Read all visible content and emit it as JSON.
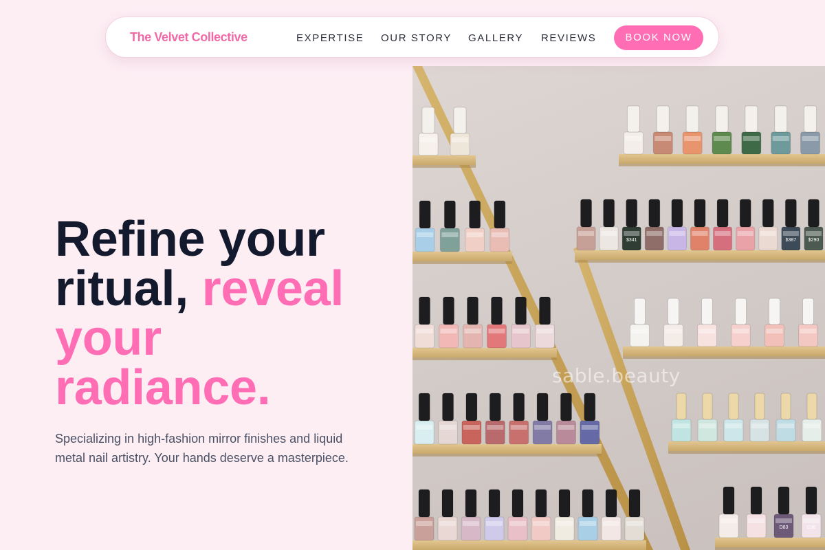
{
  "brand": {
    "name": "The Velvet Collective",
    "color": "#f06aa8"
  },
  "nav": {
    "links": [
      "EXPERTISE",
      "OUR STORY",
      "GALLERY",
      "REVIEWS"
    ],
    "cta_label": "BOOK NOW"
  },
  "hero": {
    "title_line1": "Refine your",
    "title_line2_plain": "ritual,",
    "title_accent_1": "reveal",
    "title_accent_2": "your",
    "title_accent_3": "radiance.",
    "subtitle": "Specializing in high-fashion mirror finishes and liquid metal nail artistry. Your hands deserve a masterpiece.",
    "image_watermark": "sable.beauty",
    "bottle_labels": [
      "$341",
      "$387",
      "$290",
      "D83",
      "C86"
    ]
  },
  "colors": {
    "accent": "#ff6eb4",
    "heading": "#141a2e",
    "body_text": "#4a5063",
    "page_bg": "#fdeef4"
  }
}
